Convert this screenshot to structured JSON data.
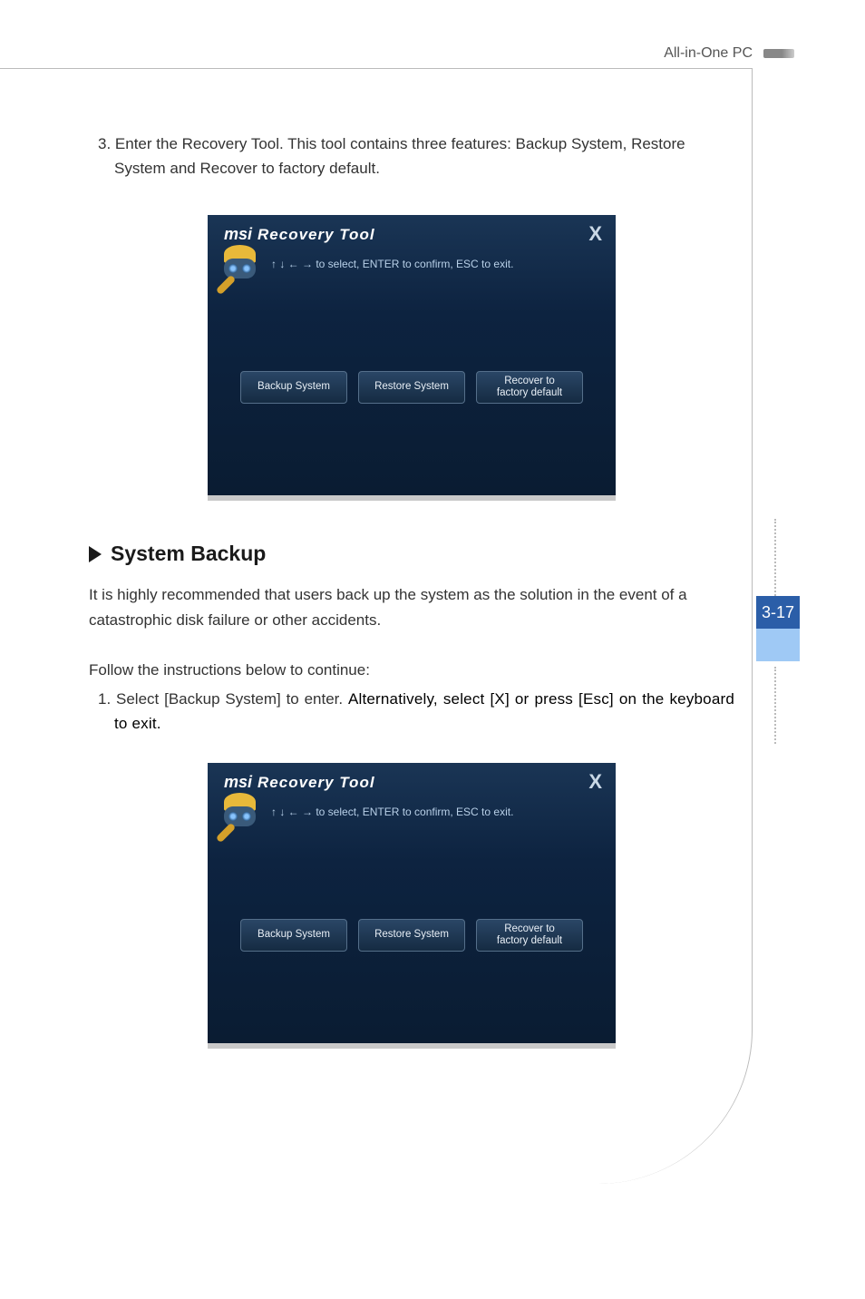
{
  "header": {
    "product": "All-in-One PC"
  },
  "page_tab": "3-17",
  "content": {
    "step3_number": "3. ",
    "step3_line1": "Enter the Recovery Tool. This tool contains three features: Backup System, Restore",
    "step3_line2": "System and Recover to factory default.",
    "screenshot1": {
      "title_prefix": "msi",
      "title_main": "Recovery Tool",
      "close": "X",
      "instruction": "↑ ↓ ← → to select, ENTER to confirm, ESC to exit.",
      "btn1": "Backup System",
      "btn2": "Restore System",
      "btn3": "Recover to\nfactory default"
    },
    "section_title": "System Backup",
    "intro_text": "It is highly recommended that users back up the system as the solution in the event of a catastrophic disk failure or other accidents.",
    "follow_text": "Follow the instructions below to continue:",
    "step1_number": "1. ",
    "step1_part1": "Select [Backup System] to enter. ",
    "step1_part2": "Alternatively, select [X] or press [Esc] on the keyboard to exit.",
    "screenshot2": {
      "title_prefix": "msi",
      "title_main": "Recovery Tool",
      "close": "X",
      "instruction": "↑ ↓ ← → to select, ENTER to confirm, ESC to exit.",
      "btn1": "Backup System",
      "btn2": "Restore System",
      "btn3": "Recover to\nfactory default"
    }
  }
}
